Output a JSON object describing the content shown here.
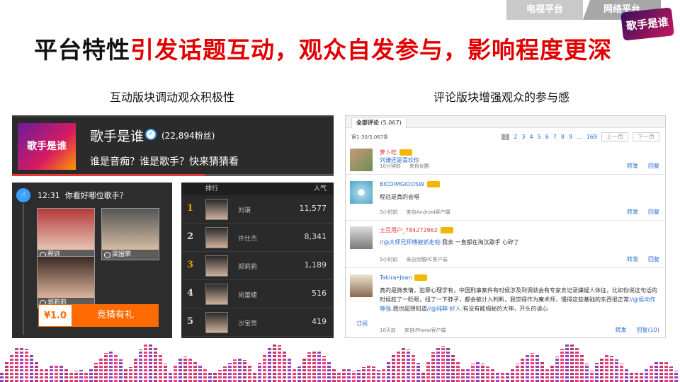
{
  "nav": {
    "tabs": [
      {
        "label": "电视平台"
      },
      {
        "label": "网络平台"
      }
    ]
  },
  "logo_text": "歌手是谁",
  "headline": {
    "plain": "平台特性",
    "highlight": "引发话题互动，观众自发参与，影响程度更深"
  },
  "subtitles": {
    "left": "互动版块调动观众积极性",
    "right": "评论版块增强观众的参与感"
  },
  "profile": {
    "name": "歌手是谁",
    "fans": "(22,894粉丝)",
    "tagline": "谁是音痴？谁是歌手？快来猜猜看",
    "avatar_text": "歌手是谁"
  },
  "guess": {
    "time": "12:31",
    "question": "你看好哪位歌手？",
    "candidates": [
      {
        "name": "程远"
      },
      {
        "name": "梁国荣"
      },
      {
        "name": "郑莉莉"
      }
    ],
    "price": "¥1.0",
    "button": "竞猜有礼"
  },
  "ranking": {
    "col_rank": "排行",
    "col_pop": "人气",
    "rows": [
      {
        "rank": "1",
        "name": "刘谦",
        "count": "11,577"
      },
      {
        "rank": "2",
        "name": "许仕杰",
        "count": "8,341"
      },
      {
        "rank": "3",
        "name": "郑莉莉",
        "count": "1,189"
      },
      {
        "rank": "4",
        "name": "尚蕾婕",
        "count": "516"
      },
      {
        "rank": "5",
        "name": "沙宝亮",
        "count": "419"
      }
    ]
  },
  "comments": {
    "tab_label": "全部评论",
    "tab_count": "(5,067)",
    "range": "第1-30/5,067条",
    "pages": [
      "1",
      "2",
      "3",
      "4",
      "5",
      "6",
      "7",
      "8",
      "9",
      "...",
      "169"
    ],
    "prev": "上一页",
    "next": "下一页",
    "follow": "订阅",
    "items": [
      {
        "user": "萝卜吃",
        "text": "刘谦还是喜欢你",
        "time": "10分钟前",
        "source": "来自优酷",
        "actions": [
          "转发",
          "回复"
        ]
      },
      {
        "user": "BICDIMGIOOSW",
        "text": "程远是真的会唱",
        "time": "3小时前",
        "source": "来自Android客户端",
        "actions": [
          "转发",
          "回复"
        ]
      },
      {
        "user": "土豆用户_784272962",
        "text_link": "//@大师兄师傅被抓走啦:",
        "text": "我去 一直都在淘汰歌手 心碎了",
        "time": "5小时前",
        "source": "来自优酷PC客户端",
        "actions": [
          "转发",
          "回复"
        ]
      },
      {
        "user": "Takira•Jean",
        "text": "真的是微表情，犯罪心理学有，中国刑事案件有时候涉及到调就会有专家去记录嫌疑人体征，比如你说这句话的时候趁了一眨眼，扭了一下脖子，都会被计入判断，我觉得作为魔术师，懂得这些基础的东西很正常",
        "text_link": "//@侯动作够强:",
        "text2": "我也超想知道",
        "text_link2": "//@纯粹·好人:",
        "text3": "有没有能揭秘的大神，开头的读心",
        "time": "10天前",
        "source": "来自iPhone客户端",
        "actions": [
          "转发",
          "回复(10)"
        ]
      }
    ]
  },
  "colors": {
    "accent_red": "#e10000",
    "orange": "#ff6a00",
    "link_blue": "#2a6dd1"
  }
}
